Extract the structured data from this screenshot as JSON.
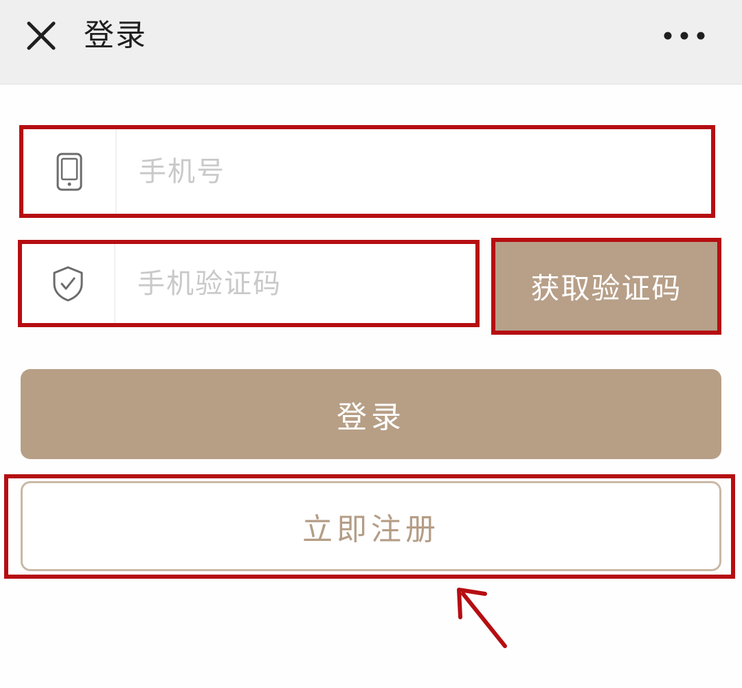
{
  "navbar": {
    "title": "登录",
    "close_icon": "close-icon",
    "more_icon": "more-dots-icon"
  },
  "form": {
    "phone": {
      "icon": "mobile-phone-icon",
      "placeholder": "手机号",
      "value": ""
    },
    "code": {
      "icon": "shield-check-icon",
      "placeholder": "手机验证码",
      "value": ""
    },
    "get_code_label": "获取验证码",
    "login_label": "登录",
    "register_label": "立即注册"
  },
  "annotation": {
    "arrow_icon": "arrow-up-left-icon"
  },
  "colors": {
    "accent": "#b79f86",
    "accent_text": "#b49d86",
    "highlight": "#b50e12",
    "navbar_bg": "#efefef"
  }
}
